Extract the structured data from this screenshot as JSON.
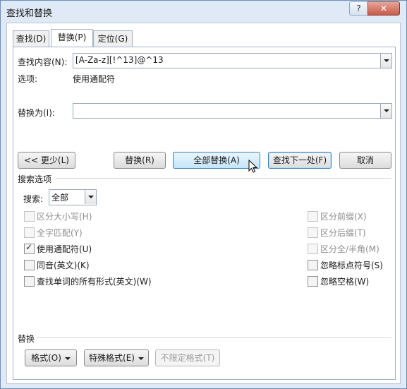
{
  "window": {
    "title": "查找和替换",
    "help_label": "?",
    "close_label": "✕"
  },
  "tabs": [
    {
      "label": "查找(D)",
      "active": false
    },
    {
      "label": "替换(P)",
      "active": true
    },
    {
      "label": "定位(G)",
      "active": false
    }
  ],
  "find": {
    "label": "查找内容(N):",
    "value": "[A-Za-z][!^13]@^13",
    "options_label": "选项:",
    "options_value": "使用通配符"
  },
  "replace": {
    "label": "替换为(I):",
    "value": ""
  },
  "buttons": {
    "less": "<< 更少(L)",
    "replace": "替换(R)",
    "replace_all": "全部替换(A)",
    "find_next": "查找下一处(F)",
    "cancel": "取消"
  },
  "search_options": {
    "title": "搜索选项",
    "search_label": "搜索:",
    "search_value": "全部",
    "left": [
      {
        "label": "区分大小写(H)",
        "checked": false,
        "enabled": false
      },
      {
        "label": "全字匹配(Y)",
        "checked": false,
        "enabled": false
      },
      {
        "label": "使用通配符(U)",
        "checked": true,
        "enabled": true
      },
      {
        "label": "同音(英文)(K)",
        "checked": false,
        "enabled": true
      },
      {
        "label": "查找单词的所有形式(英文)(W)",
        "checked": false,
        "enabled": true
      }
    ],
    "right": [
      {
        "label": "区分前缀(X)",
        "checked": false,
        "enabled": false
      },
      {
        "label": "区分后缀(T)",
        "checked": false,
        "enabled": false
      },
      {
        "label": "区分全/半角(M)",
        "checked": false,
        "enabled": false
      },
      {
        "label": "忽略标点符号(S)",
        "checked": false,
        "enabled": true
      },
      {
        "label": "忽略空格(W)",
        "checked": false,
        "enabled": true
      }
    ]
  },
  "replace_section": {
    "title": "替换",
    "format_label": "格式(O)",
    "special_label": "特殊格式(E)",
    "no_format_label": "不限定格式(T)"
  }
}
